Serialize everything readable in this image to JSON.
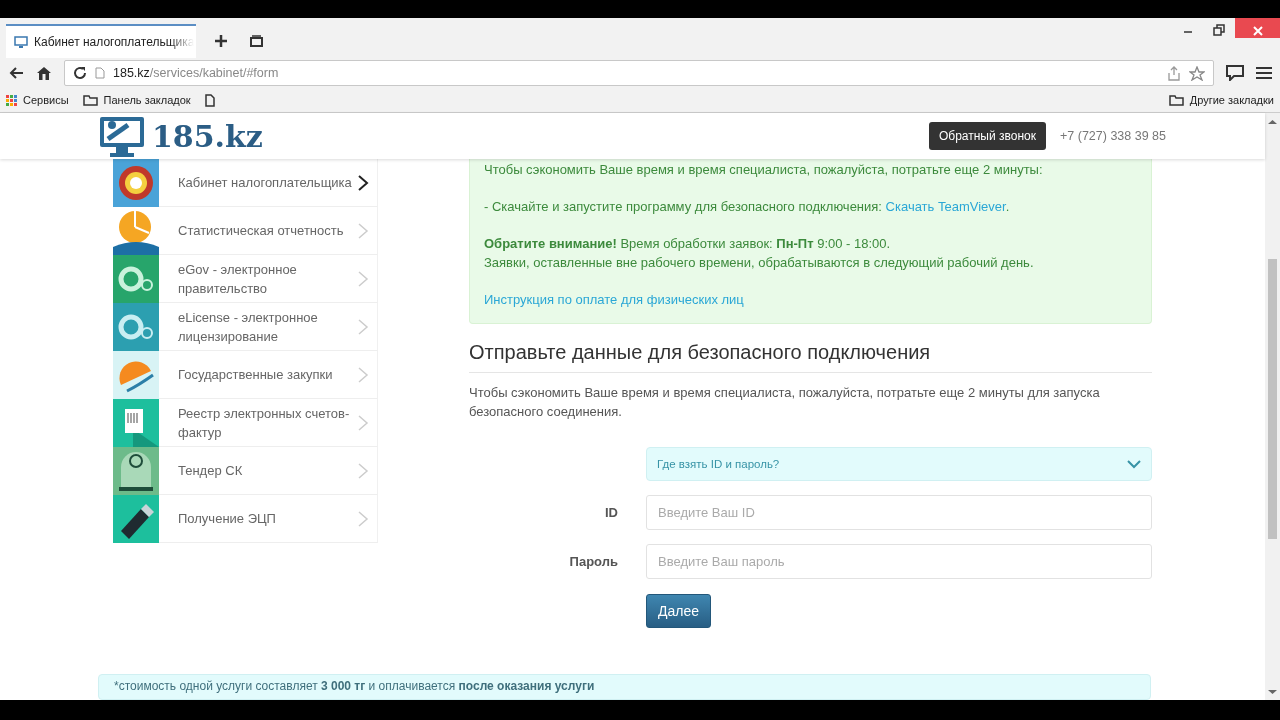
{
  "browser": {
    "tab_title": "Кабинет налогоплательщика",
    "url_host": "185.kz",
    "url_path": "/services/kabinet/#form",
    "bookmarks": [
      {
        "label": "Сервисы",
        "kind": "apps"
      },
      {
        "label": "Панель закладок",
        "kind": "folder"
      }
    ],
    "other_bookmarks": "Другие закладки"
  },
  "header": {
    "logo": "185.kz",
    "callback_button": "Обратный звонок",
    "phone": "+7 (727) 338 39 85"
  },
  "sidebar": {
    "items": [
      {
        "label": "Кабинет налогоплательщика",
        "selected": true
      },
      {
        "label": "Статистическая отчетность",
        "selected": false
      },
      {
        "label": "eGov - электронное правительство",
        "selected": false
      },
      {
        "label": "eLicense - электронное лицензирование",
        "selected": false
      },
      {
        "label": "Государственные закупки",
        "selected": false
      },
      {
        "label": "Реестр электронных счетов-фактур",
        "selected": false
      },
      {
        "label": "Тендер СК",
        "selected": false
      },
      {
        "label": "Получение ЭЦП",
        "selected": false
      }
    ]
  },
  "alert": {
    "intro": "Чтобы сэкономить Ваше время и время специалиста, пожалуйста, потратьте еще 2 минуты:",
    "download_text": "- Скачайте и запустите программу для безопасного подключения: ",
    "download_link": "Скачать TeamViever",
    "download_suffix": ".",
    "notice": "**Обратите внимание!** Время обработки заявок: **Пн-Пт** 9:00 - 18:00.",
    "notice_2": "Заявки, оставленные вне рабочего времени, обрабатываются в следующий рабочий день.",
    "payment_link": "Инструкция по оплате для физических лиц"
  },
  "form": {
    "heading": "Отправьте данные для безопасного подключения",
    "description": "Чтобы сэкономить Ваше время и время специалиста, пожалуйста, потратьте еще 2 минуты для запуска безопасного соединения.",
    "help": {
      "label": "Где взять ID и пароль?",
      "expanded": false
    },
    "fields": [
      {
        "label": "ID",
        "placeholder": "Введите Ваш ID"
      },
      {
        "label": "Пароль",
        "placeholder": "Введите Ваш пароль"
      }
    ],
    "submit": "Далее"
  },
  "footer_note": "*стоимость одной услуги составляет **3 000 тг** и оплачивается **после оказания услуги**"
}
